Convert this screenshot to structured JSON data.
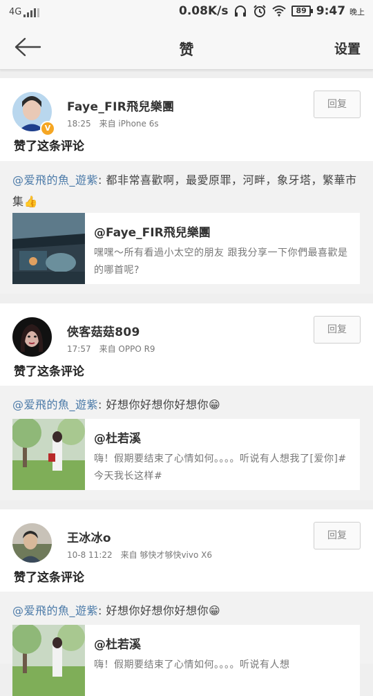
{
  "status_bar": {
    "network": "4G",
    "speed": "0.08K/s",
    "battery": "89",
    "time": "9:47",
    "ampm": "晚上",
    "icons": [
      "signal-icon",
      "headphones-icon",
      "alarm-icon",
      "wifi-icon",
      "battery-icon"
    ]
  },
  "header": {
    "title": "赞",
    "settings": "设置",
    "back_icon": "back-arrow-icon"
  },
  "items": [
    {
      "username": "Faye_FIR飛兒樂團",
      "time": "18:25",
      "source": "来自 iPhone 6s",
      "reply": "回复",
      "action": "赞了这条评论",
      "comment_mention": "@爱飛的魚_遊紫",
      "comment_text": ": 都非常喜歡啊，最愛原罪，河畔，象牙塔，繁華市集👍",
      "quote_name": "@Faye_FIR飛兒樂團",
      "quote_text": "嘿嘿～所有看過小太空的朋友 跟我分享一下你們最喜歡是的哪首呢?",
      "verified": true
    },
    {
      "username": "俠客菇菇809",
      "time": "17:57",
      "source": "来自 OPPO R9",
      "reply": "回复",
      "action": "赞了这条评论",
      "comment_mention": "@爱飛的魚_遊紫",
      "comment_text": ": 好想你好想你好想你😁",
      "quote_name": "@杜若溪",
      "quote_text": "嗨！假期要结束了心情如何。。。。听说有人想我了[爱你]#今天我长这样#",
      "verified": false
    },
    {
      "username": "王冰冰o",
      "time": "10-8 11:22",
      "source": "来自 够快才够快vivo X6",
      "reply": "回复",
      "action": "赞了这条评论",
      "comment_mention": "@爱飛的魚_遊紫",
      "comment_text": ": 好想你好想你好想你😁",
      "quote_name": "@杜若溪",
      "quote_text": "嗨！假期要结束了心情如何。。。。听说有人想",
      "verified": false
    }
  ],
  "colors": {
    "mention": "#4b7aa8",
    "background": "#efefef",
    "card": "#ffffff",
    "verified_badge": "#f5a623"
  }
}
